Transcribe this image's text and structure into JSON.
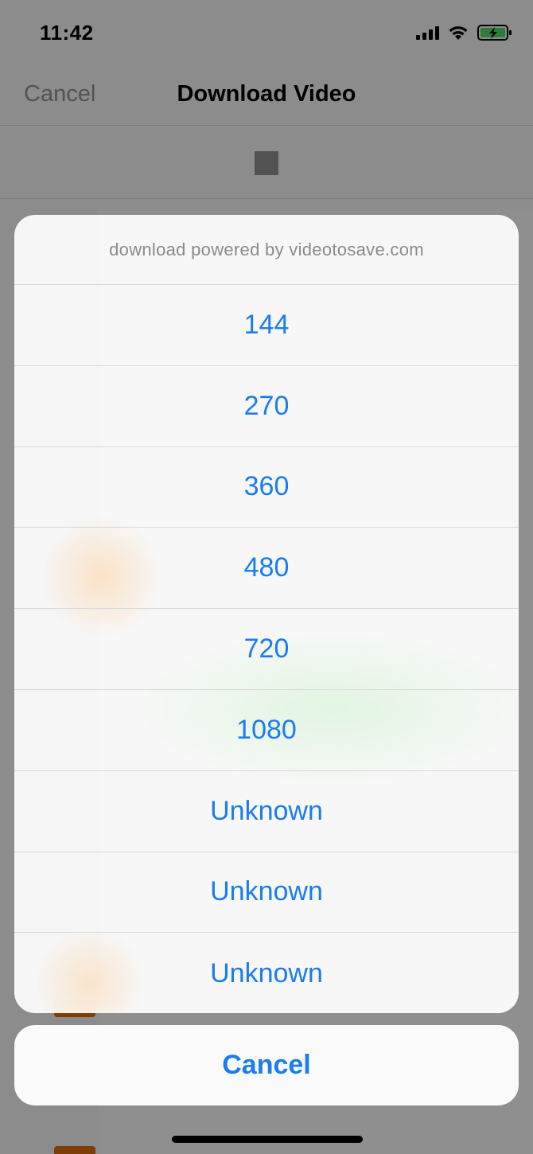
{
  "status_bar": {
    "time": "11:42"
  },
  "nav": {
    "cancel_label": "Cancel",
    "title": "Download Video"
  },
  "action_sheet": {
    "header": "download powered by videotosave.com",
    "options": [
      "144",
      "270",
      "360",
      "480",
      "720",
      "1080",
      "Unknown",
      "Unknown",
      "Unknown"
    ],
    "cancel_label": "Cancel"
  },
  "colors": {
    "accent": "#1a7cf0",
    "battery_green": "#4cd964"
  }
}
